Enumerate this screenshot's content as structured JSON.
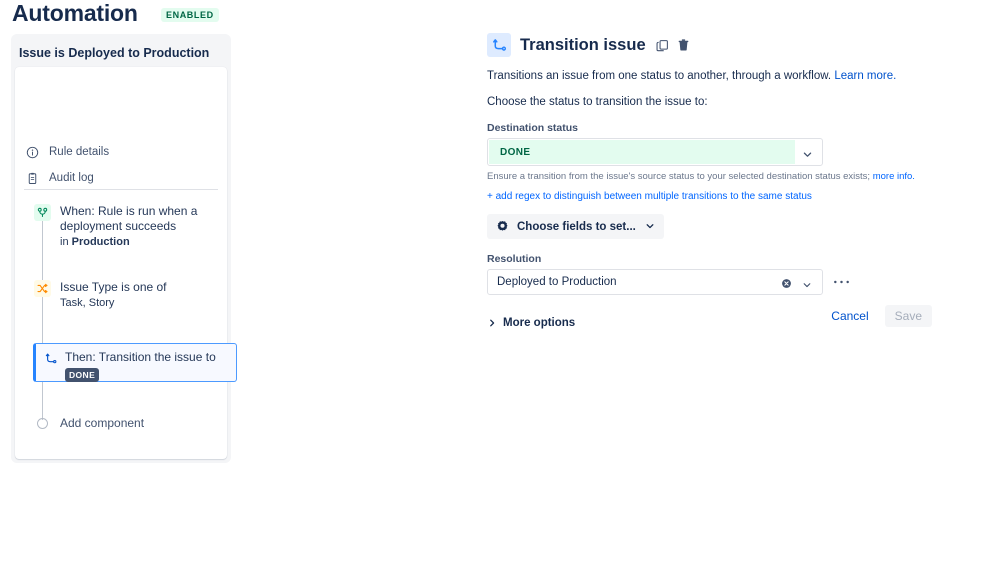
{
  "header": {
    "title": "Automation",
    "status_badge": "ENABLED"
  },
  "rule_panel": {
    "title": "Issue is Deployed to Production",
    "nav": [
      {
        "label": "Rule details",
        "icon": "info-circle-icon"
      },
      {
        "label": "Audit log",
        "icon": "clipboard-icon"
      }
    ],
    "tree": {
      "trigger": {
        "title": "When: Rule is run when a deployment succeeds",
        "sub_prefix": "in ",
        "sub_bold": "Production",
        "icon": "branch-merge-icon",
        "icon_bg": "#e3fcef"
      },
      "condition": {
        "title": "Issue Type is one of",
        "sub": "Task, Story",
        "icon": "shuffle-icon",
        "icon_bg": "#fffae6"
      },
      "action": {
        "title": "Then: Transition the issue to",
        "chip": "DONE",
        "icon": "transition-arrow-icon",
        "selected": true
      },
      "add_component": {
        "label": "Add component",
        "icon": "circle-outline-icon"
      }
    }
  },
  "detail": {
    "icon": "transition-arrow-icon",
    "title": "Transition issue",
    "actions": [
      {
        "name": "duplicate-icon",
        "title": "Duplicate"
      },
      {
        "name": "delete-icon",
        "title": "Delete"
      }
    ],
    "description_text": "Transitions an issue from one status to another, through a workflow. ",
    "description_link": "Learn more.",
    "prompt": "Choose the status to transition the issue to:",
    "destination_status": {
      "label": "Destination status",
      "value": "DONE",
      "value_color": "#006644",
      "value_bg": "#e3fcef",
      "help_text": "Ensure a transition from the issue's source status to your selected destination status exists; ",
      "help_link": "more info.",
      "regex_link": "+ add regex to distinguish between multiple transitions to the same status"
    },
    "choose_fields": {
      "label": "Choose fields to set...",
      "icon": "gear-icon"
    },
    "resolution": {
      "label": "Resolution",
      "value": "Deployed to Production",
      "clear_icon": "clear-circle-icon",
      "more_icon": "ellipsis-icon"
    },
    "more_options": {
      "label": "More options",
      "icon": "chevron-right-icon"
    },
    "footer": {
      "cancel_label": "Cancel",
      "save_label": "Save"
    }
  }
}
